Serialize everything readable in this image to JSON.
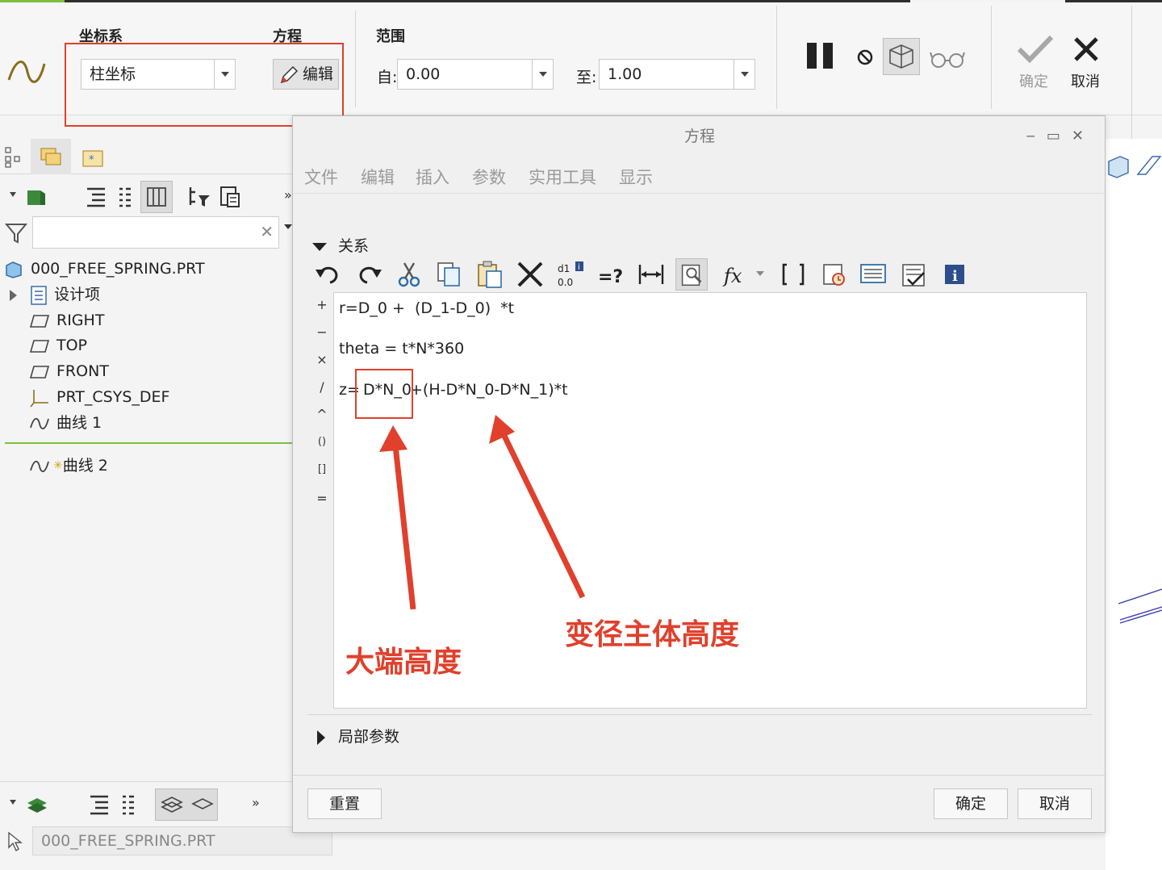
{
  "ribbon": {
    "coord_label": "坐标系",
    "coord_value": "柱坐标",
    "equation_label": "方程",
    "edit_button": "编辑",
    "range_label": "范围",
    "from_label": "自:",
    "from_value": "0.00",
    "to_label": "至:",
    "to_value": "1.00",
    "confirm_label": "确定",
    "cancel_label": "取消"
  },
  "tree": {
    "filter_placeholder": "",
    "model_name": "000_FREE_SPRING.PRT",
    "items": [
      {
        "label": "设计项"
      },
      {
        "label": "RIGHT"
      },
      {
        "label": "TOP"
      },
      {
        "label": "FRONT"
      },
      {
        "label": "PRT_CSYS_DEF"
      },
      {
        "label": "曲线 1"
      },
      {
        "label": "曲线 2"
      }
    ],
    "bottom_model": "000_FREE_SPRING.PRT"
  },
  "dialog": {
    "title": "方程",
    "menu": [
      "文件",
      "编辑",
      "插入",
      "参数",
      "实用工具",
      "显示"
    ],
    "relations_header": "关系",
    "operators": [
      "+",
      "−",
      "×",
      "/",
      "^",
      "()",
      "[]",
      "="
    ],
    "lines": [
      "r=D_0 +  (D_1-D_0)  *t",
      "theta = t*N*360",
      "z=",
      "D*N_0",
      "+(H-D*N_0-D*N_1)*t"
    ],
    "local_params": "局部参数",
    "reset_button": "重置",
    "ok_button": "确定",
    "cancel_button": "取消"
  },
  "annotations": {
    "big_end_height": "大端高度",
    "body_height": "变径主体高度"
  },
  "colors": {
    "annotation_red": "#e0402c",
    "tree_green": "#7bc043"
  }
}
